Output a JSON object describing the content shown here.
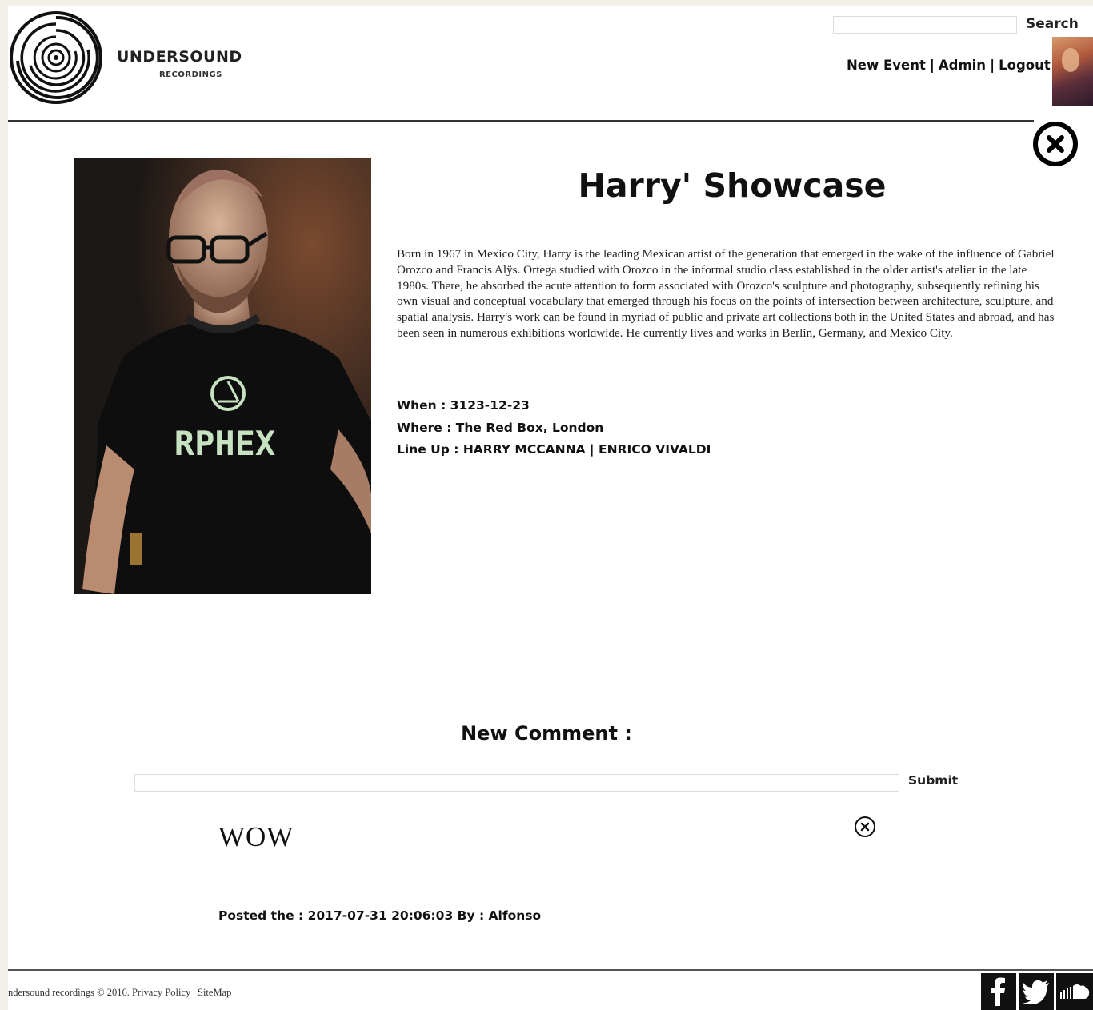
{
  "header": {
    "brand_name": "UNDERSOUND",
    "brand_sub": "RECORDINGS",
    "search_placeholder": "",
    "search_label": "Search",
    "nav": [
      {
        "label": "New Event"
      },
      {
        "label": "Admin"
      },
      {
        "label": "Logout"
      }
    ],
    "separator": "|"
  },
  "event": {
    "title": "Harry' Showcase",
    "bio": "Born in 1967 in Mexico City, Harry is the leading Mexican artist of the generation that emerged in the wake of the influence of Gabriel Orozco and Francis Alÿs. Ortega studied with Orozco in the informal studio class established in the older artist's atelier in the late 1980s. There, he absorbed the acute attention to form associated with Orozco's sculpture and photography, subsequently refining his own visual and conceptual vocabulary that emerged through his focus on the points of intersection between architecture, sculpture, and spatial analysis. Harry's work can be found in myriad of public and private art collections both in the United States and abroad, and has been seen in numerous exhibitions worldwide. He currently lives and works in Berlin, Germany, and Mexico City.",
    "when_label": "When : ",
    "when_value": "3123-12-23",
    "where_label": "Where : ",
    "where_value": "The Red Box, London",
    "lineup_label": "Line Up : ",
    "lineup_value": "HARRY MCCANNA | ENRICO VIVALDI",
    "shirt_text": "RPHEX"
  },
  "comments": {
    "heading": "New Comment :",
    "input_placeholder": "",
    "submit_label": "Submit",
    "items": [
      {
        "text": "WOW",
        "meta": "Posted the : 2017-07-31 20:06:03 By : Alfonso"
      }
    ]
  },
  "footer": {
    "copyright": "ndersound recordings © 2016. ",
    "privacy": "Privacy Policy",
    "divider": " | ",
    "sitemap": "SiteMap",
    "social": [
      "facebook",
      "twitter",
      "soundcloud"
    ]
  },
  "colors": {
    "page_bg": "#f3f0ea",
    "content_bg": "#ffffff",
    "text": "#111111",
    "social_bg": "#111111"
  }
}
